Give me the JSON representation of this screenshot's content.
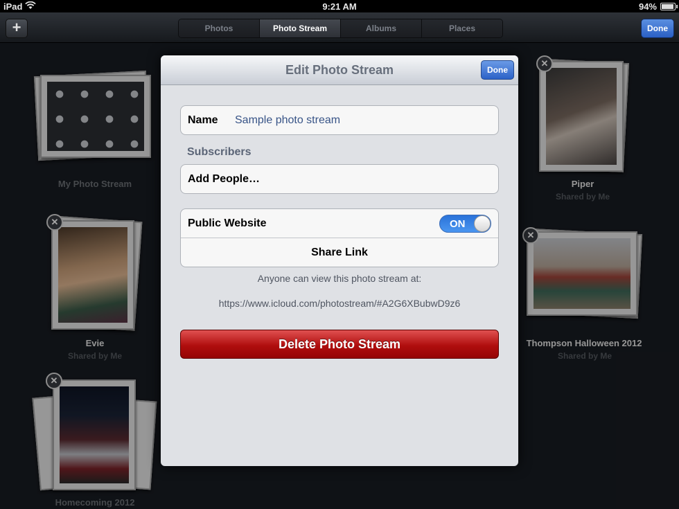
{
  "status_bar": {
    "device": "iPad",
    "time": "9:21 AM",
    "battery": "94%"
  },
  "toolbar": {
    "add_label": "+",
    "tabs": [
      {
        "label": "Photos"
      },
      {
        "label": "Photo Stream"
      },
      {
        "label": "Albums"
      },
      {
        "label": "Places"
      }
    ],
    "done_label": "Done"
  },
  "streams": [
    {
      "title": "My Photo Stream",
      "subtitle": ""
    },
    {
      "title": "Piper",
      "subtitle": "Shared by Me"
    },
    {
      "title": "Evie",
      "subtitle": "Shared by Me"
    },
    {
      "title": "Thompson Halloween 2012",
      "subtitle": "Shared by Me"
    },
    {
      "title": "Homecoming 2012",
      "subtitle": ""
    }
  ],
  "modal": {
    "title": "Edit Photo Stream",
    "done_label": "Done",
    "name_label": "Name",
    "name_value": "Sample photo stream",
    "subscribers_label": "Subscribers",
    "add_people_label": "Add People…",
    "public_website_label": "Public Website",
    "toggle_label": "ON",
    "share_link_label": "Share Link",
    "note": "Anyone can view this photo stream at:",
    "url": "https://www.icloud.com/photostream/#A2G6XBubwD9z6",
    "delete_label": "Delete Photo Stream"
  },
  "colors": {
    "accent": "#2c62c8",
    "toggle_on": "#2a72d9",
    "delete": "#b00e0e"
  }
}
